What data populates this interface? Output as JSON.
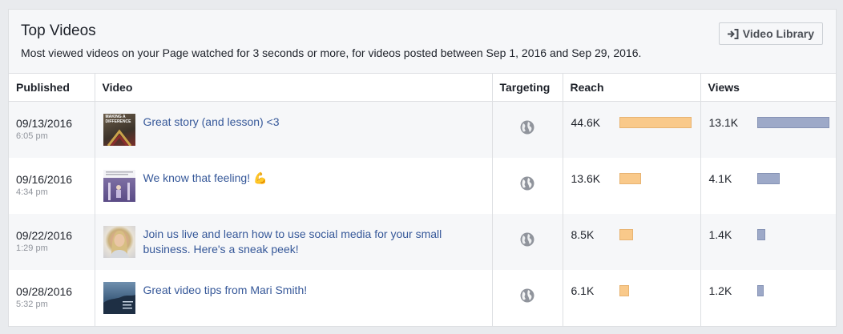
{
  "header": {
    "title": "Top Videos",
    "subtitle": "Most viewed videos on your Page watched for 3 seconds or more, for videos posted between Sep 1, 2016 and Sep 29, 2016.",
    "library_button": "Video Library"
  },
  "columns": {
    "published": "Published",
    "video": "Video",
    "targeting": "Targeting",
    "reach": "Reach",
    "views": "Views"
  },
  "thumb_text": "MAKING A DIFFERENCE",
  "rows": [
    {
      "date": "09/13/2016",
      "time": "6:05 pm",
      "title": "Great story (and lesson) <3",
      "targeting_icon": "globe-icon",
      "reach": "44.6K",
      "reach_fraction": 1.0,
      "views": "13.1K",
      "views_fraction": 1.0
    },
    {
      "date": "09/16/2016",
      "time": "4:34 pm",
      "title": "We know that feeling! 💪",
      "targeting_icon": "globe-icon",
      "reach": "13.6K",
      "reach_fraction": 0.305,
      "views": "4.1K",
      "views_fraction": 0.313
    },
    {
      "date": "09/22/2016",
      "time": "1:29 pm",
      "title": "Join us live and learn how to use social media for your small business. Here's a sneak peek!",
      "targeting_icon": "globe-icon",
      "reach": "8.5K",
      "reach_fraction": 0.191,
      "views": "1.4K",
      "views_fraction": 0.107
    },
    {
      "date": "09/28/2016",
      "time": "5:32 pm",
      "title": "Great video tips from Mari Smith!",
      "targeting_icon": "globe-icon",
      "reach": "6.1K",
      "reach_fraction": 0.137,
      "views": "1.2K",
      "views_fraction": 0.092
    }
  ],
  "colors": {
    "link": "#365899",
    "reach_bar": "#f9c98a",
    "views_bar": "#9da9c8"
  }
}
